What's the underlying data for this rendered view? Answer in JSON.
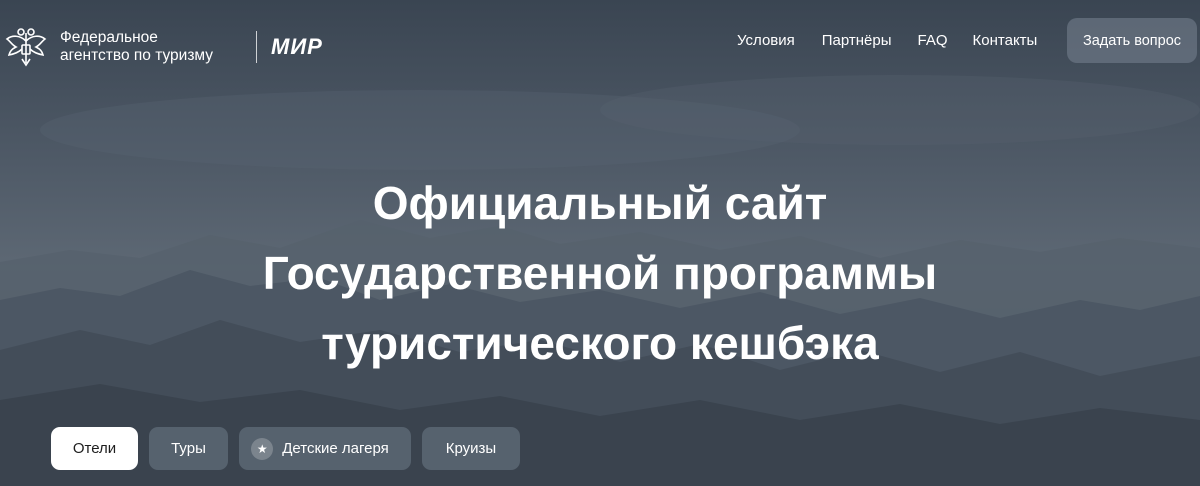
{
  "header": {
    "agency_line1": "Федеральное",
    "agency_line2": "агентство по туризму",
    "partner_logo": "МИР",
    "nav": [
      "Условия",
      "Партнёры",
      "FAQ",
      "Контакты"
    ],
    "cta_label": "Задать вопрос"
  },
  "hero": {
    "title_lines": [
      "Официальный сайт",
      "Государственной программы",
      "туристического кешбэка"
    ]
  },
  "tabs": [
    {
      "label": "Отели",
      "active": true
    },
    {
      "label": "Туры",
      "active": false
    },
    {
      "label": "Детские лагеря",
      "active": false,
      "icon": "star-icon"
    },
    {
      "label": "Круизы",
      "active": false
    }
  ],
  "colors": {
    "background": "#4a5562",
    "button": "#7a8592",
    "active_tab": "#ffffff"
  }
}
